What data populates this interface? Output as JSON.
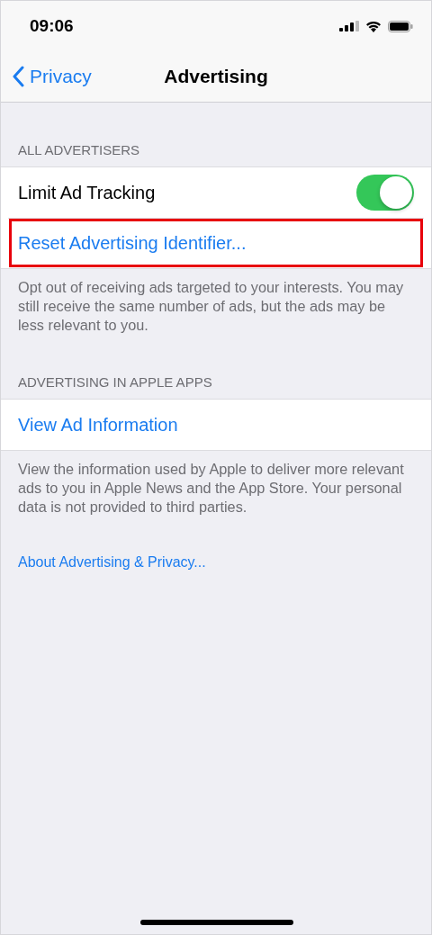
{
  "status_bar": {
    "time": "09:06"
  },
  "nav": {
    "back": "Privacy",
    "title": "Advertising"
  },
  "sections": [
    {
      "header": "ALL ADVERTISERS",
      "rows": [
        {
          "kind": "toggle",
          "label": "Limit Ad Tracking",
          "on": true
        },
        {
          "kind": "link",
          "label": "Reset Advertising Identifier...",
          "highlighted": true
        }
      ],
      "footer": "Opt out of receiving ads targeted to your interests. You may still receive the same number of ads, but the ads may be less relevant to you."
    },
    {
      "header": "ADVERTISING IN APPLE APPS",
      "rows": [
        {
          "kind": "link",
          "label": "View Ad Information",
          "highlighted": false
        }
      ],
      "footer": "View the information used by Apple to deliver more relevant ads to you in Apple News and the App Store. Your personal data is not provided to third parties."
    }
  ],
  "bottom_link": "About Advertising & Privacy..."
}
